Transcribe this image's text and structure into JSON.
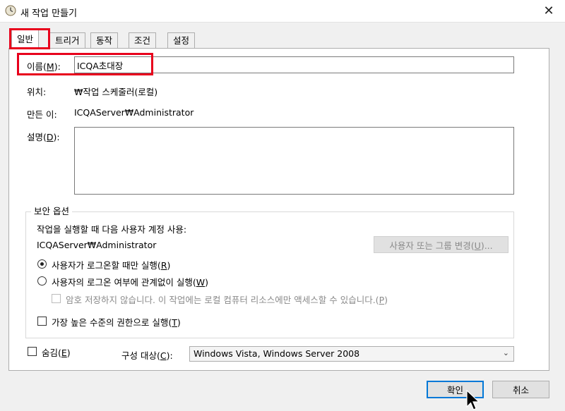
{
  "window": {
    "title": "새 작업 만들기",
    "close_glyph": "✕"
  },
  "tabs": [
    {
      "label": "일반"
    },
    {
      "label": "트리거"
    },
    {
      "label": "동작"
    },
    {
      "label": "조건"
    },
    {
      "label": "설정"
    }
  ],
  "general": {
    "name_label_pre": "이름(",
    "name_label_key": "M",
    "name_label_post": "):",
    "name_value": "ICQA초대장",
    "location_label": "위치:",
    "location_value": "₩작업 스케줄러(로컬)",
    "author_label": "만든 이:",
    "author_value": "ICQAServer₩Administrator",
    "desc_label_pre": "설명(",
    "desc_label_key": "D",
    "desc_label_post": "):",
    "desc_value": ""
  },
  "security": {
    "group_title": "보안 옵션",
    "run_as_text": "작업을 실행할 때 다음 사용자 계정 사용:",
    "account": "ICQAServer₩Administrator",
    "change_user_pre": "사용자 또는 그룹 변경(",
    "change_user_key": "U",
    "change_user_post": ")...",
    "radio1_pre": "사용자가 로그온할 때만 실행(",
    "radio1_key": "R",
    "radio1_post": ")",
    "radio2_pre": "사용자의 로그온 여부에 관계없이 실행(",
    "radio2_key": "W",
    "radio2_post": ")",
    "nopw_pre": "암호 저장하지 않습니다. 이 작업에는 로컬 컴퓨터 리소스에만 액세스할 수 있습니다.(",
    "nopw_key": "P",
    "nopw_post": ")",
    "highest_pre": "가장 높은 수준의 권한으로 실행(",
    "highest_key": "T",
    "highest_post": ")"
  },
  "bottom": {
    "hidden_pre": "숨김(",
    "hidden_key": "E",
    "hidden_post": ")",
    "config_pre": "구성 대상(",
    "config_key": "C",
    "config_post": "):",
    "config_value": "Windows Vista, Windows Server 2008",
    "ok": "확인",
    "cancel": "취소"
  },
  "colors": {
    "highlight": "#e8001c",
    "default_button_border": "#0078d7"
  }
}
